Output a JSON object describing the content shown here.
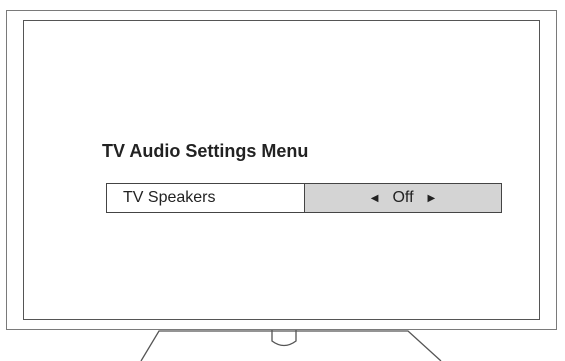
{
  "menu": {
    "title": "TV Audio Settings Menu",
    "setting": {
      "label": "TV Speakers",
      "value": "Off",
      "prev_icon": "left-arrow-icon",
      "next_icon": "right-arrow-icon"
    }
  },
  "colors": {
    "value_background": "#d4d4d4",
    "border": "#444444"
  }
}
